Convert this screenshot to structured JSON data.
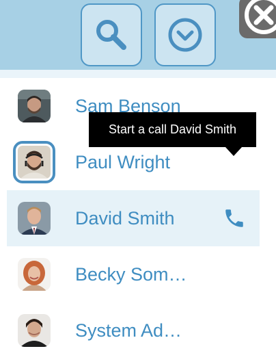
{
  "toolbar": {
    "search_icon": "search-icon",
    "dropdown_icon": "chevron-down-circle-icon",
    "close_icon": "close-icon"
  },
  "contacts": [
    {
      "name": "Sam Benson",
      "avatar": "avatar-photo"
    },
    {
      "name": "Paul Wright",
      "avatar": "avatar-photo",
      "selected": true
    },
    {
      "name": "David Smith",
      "avatar": "avatar-photo",
      "hovered": true,
      "action_icon": "phone-icon"
    },
    {
      "name": "Becky Som…",
      "avatar": "avatar-photo"
    },
    {
      "name": "System Ad…",
      "avatar": "avatar-photo"
    }
  ],
  "tooltip": {
    "text": "Start a call David Smith"
  },
  "colors": {
    "toolbar_bg": "#a7d0e5",
    "button_bg": "#cce4f1",
    "accent": "#3f8dc1",
    "row_highlight": "#e6f2f8",
    "tooltip_bg": "#000000"
  }
}
